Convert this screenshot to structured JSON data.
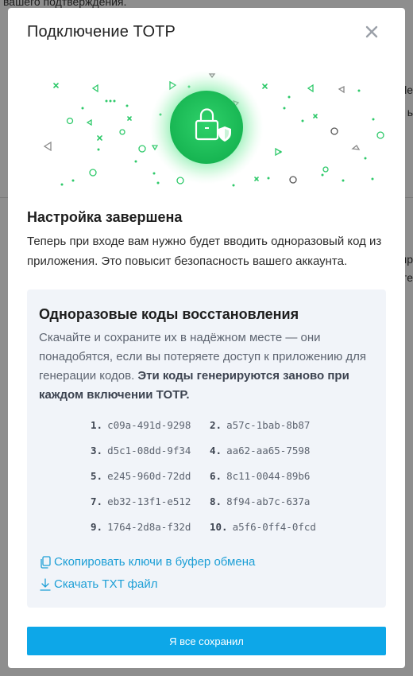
{
  "background": {
    "top_text": "вашего подтверждения.",
    "fragments": [
      "le",
      "ь",
      "пр",
      "те"
    ]
  },
  "modal": {
    "title": "Подключение TOTP",
    "close_icon": "close-icon"
  },
  "setup": {
    "title": "Настройка завершена",
    "text": "Теперь при входе вам нужно будет вводить одноразовый код из приложения. Это повысит безопасность вашего аккаунта."
  },
  "recovery": {
    "title": "Одноразовые коды восстановления",
    "desc": "Скачайте и сохраните их в надёжном месте — они понадобятся, если вы потеряете доступ к приложению для генерации кодов. ",
    "desc_bold": "Эти коды генерируются заново при каждом включении TOTP.",
    "codes": [
      {
        "num": "1.",
        "code": "c09a-491d-9298"
      },
      {
        "num": "2.",
        "code": "a57c-1bab-8b87"
      },
      {
        "num": "3.",
        "code": "d5c1-08dd-9f34"
      },
      {
        "num": "4.",
        "code": "aa62-aa65-7598"
      },
      {
        "num": "5.",
        "code": "e245-960d-72dd"
      },
      {
        "num": "6.",
        "code": "8c11-0044-89b6"
      },
      {
        "num": "7.",
        "code": "eb32-13f1-e512"
      },
      {
        "num": "8.",
        "code": "8f94-ab7c-637a"
      },
      {
        "num": "9.",
        "code": "1764-2d8a-f32d"
      },
      {
        "num": "10.",
        "code": "a5f6-0ff4-0fcd"
      }
    ],
    "copy_label": "Скопировать ключи в буфер обмена",
    "download_label": "Скачать TXT файл"
  },
  "save_button": "Я все сохранил",
  "colors": {
    "accent": "#0da7e8",
    "link": "#1d9fd6",
    "hero_green": "#22c55e"
  }
}
